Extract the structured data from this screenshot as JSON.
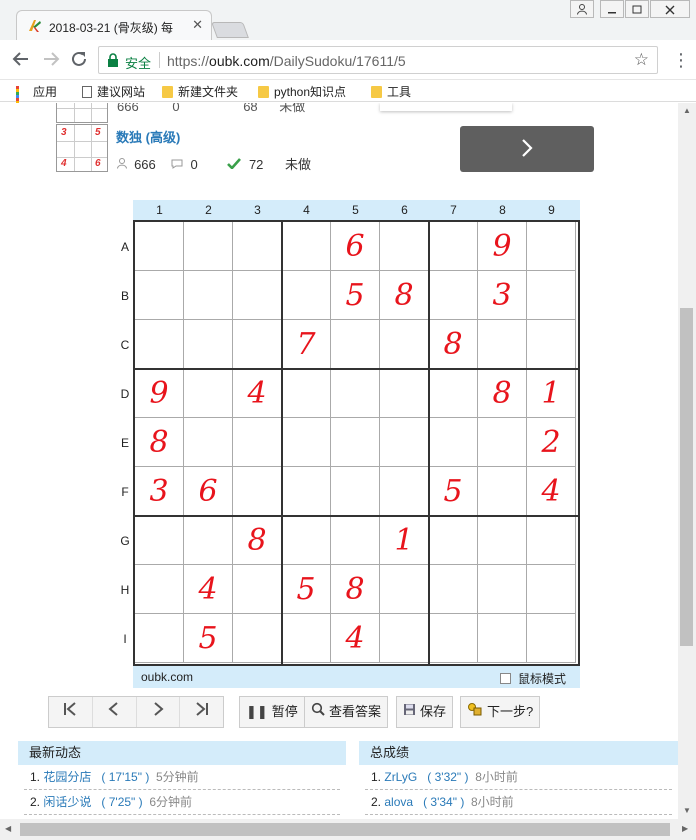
{
  "browser": {
    "tab_title": "2018-03-21 (骨灰级) 每",
    "tab_close": "✕",
    "secure_label": "安全",
    "url_scheme": "https://",
    "url_host": "oubk.com",
    "url_path": "/DailySudoku/17611/5",
    "bookmarks": [
      {
        "label": "应用",
        "icon": "apps-icon"
      },
      {
        "label": "建议网站",
        "icon": "page-icon"
      },
      {
        "label": "新建文件夹",
        "icon": "folder-icon"
      },
      {
        "label": "python知识点",
        "icon": "folder-icon"
      },
      {
        "label": "工具",
        "icon": "folder-icon"
      }
    ]
  },
  "puzzle_header": {
    "partial_stats": {
      "views": "666",
      "comments": "0",
      "solved": "68",
      "status": "未做"
    },
    "title": "数独 (高级)",
    "views": "666",
    "comments": "0",
    "solved": "72",
    "status": "未做",
    "thumbnail_digits": [
      "3",
      "5",
      "4",
      "6"
    ],
    "next_arrow": "›"
  },
  "board": {
    "columns": [
      "1",
      "2",
      "3",
      "4",
      "5",
      "6",
      "7",
      "8",
      "9"
    ],
    "rows": [
      "A",
      "B",
      "C",
      "D",
      "E",
      "F",
      "G",
      "H",
      "I"
    ],
    "cells": [
      [
        "",
        "",
        "",
        "",
        "6",
        "",
        "",
        "9",
        ""
      ],
      [
        "",
        "",
        "",
        "",
        "5",
        "8",
        "",
        "3",
        ""
      ],
      [
        "",
        "",
        "",
        "7",
        "",
        "",
        "8",
        "",
        ""
      ],
      [
        "9",
        "",
        "4",
        "",
        "",
        "",
        "",
        "8",
        "1"
      ],
      [
        "8",
        "",
        "",
        "",
        "",
        "",
        "",
        "",
        "2"
      ],
      [
        "3",
        "6",
        "",
        "",
        "",
        "",
        "5",
        "",
        "4"
      ],
      [
        "",
        "",
        "8",
        "",
        "",
        "1",
        "",
        "",
        ""
      ],
      [
        "",
        "4",
        "",
        "5",
        "8",
        "",
        "",
        "",
        ""
      ],
      [
        "",
        "5",
        "",
        "",
        "4",
        "",
        "",
        "",
        ""
      ]
    ],
    "footer_site": "oubk.com",
    "mouse_mode_label": "鼠标模式"
  },
  "controls": {
    "nav": [
      "|‹",
      "‹",
      "›",
      "›|"
    ],
    "pause": "暂停",
    "view_answer": "查看答案",
    "save": "保存",
    "next_step": "下一步?"
  },
  "panels": {
    "recent": {
      "title": "最新动态",
      "rows": [
        {
          "rank": "1.",
          "name": "花园分店",
          "time": "17'15\"",
          "ago": "5分钟前"
        },
        {
          "rank": "2.",
          "name": "闲话少说",
          "time": "7'25\"",
          "ago": "6分钟前"
        }
      ]
    },
    "total": {
      "title": "总成绩",
      "rows": [
        {
          "rank": "1.",
          "name": "ZrLyG",
          "time": "3'32\"",
          "ago": "8小时前"
        },
        {
          "rank": "2.",
          "name": "alova",
          "time": "3'34\"",
          "ago": "8小时前"
        }
      ]
    }
  }
}
